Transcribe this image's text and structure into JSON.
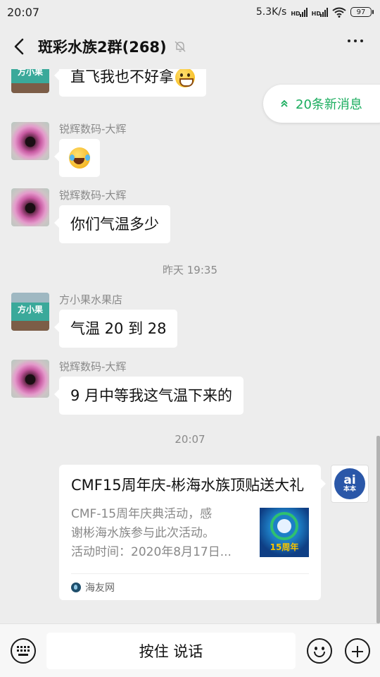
{
  "status_bar": {
    "time": "20:07",
    "speed": "5.3K/s",
    "network1": "HD",
    "network2": "HD",
    "battery": "97"
  },
  "header": {
    "title": "斑彩水族2群(268)",
    "back_icon": "chevron-left-icon",
    "mute_icon": "bell-off-icon",
    "more_icon": "more-horizontal-icon"
  },
  "new_messages": {
    "label": "20条新消息",
    "icon": "double-chevron-up-icon",
    "color": "#1aad5e"
  },
  "messages": [
    {
      "sender": "",
      "avatar_text": "方小果",
      "text": "直飞我也不好拿",
      "emoji": "grin-emoji"
    },
    {
      "sender": "锐辉数码-大辉",
      "text": "",
      "emoji": "laughing-tears-emoji"
    },
    {
      "sender": "锐辉数码-大辉",
      "text": "你们气温多少"
    },
    {
      "sender": "方小果水果店",
      "avatar_text": "方小果",
      "text": "气温 20 到 28"
    },
    {
      "sender": "锐辉数码-大辉",
      "text": "9 月中等我这气温下来的"
    }
  ],
  "timestamps": [
    "昨天 19:35",
    "20:07"
  ],
  "link_card": {
    "title": "CMF15周年庆-彬海水族顶贴送大礼",
    "desc_lines": [
      "CMF-15周年庆典活动，感",
      "谢彬海水族参与此次活动。",
      "活动时间：2020年8月17日..."
    ],
    "thumb_text": "15周年",
    "source": "海友网",
    "avatar_letter": "ai",
    "avatar_sub": "本本"
  },
  "input_bar": {
    "voice_label": "按住 说话",
    "keyboard_icon": "keyboard-icon",
    "emoji_icon": "smiley-icon",
    "plus_icon": "plus-circle-icon"
  }
}
